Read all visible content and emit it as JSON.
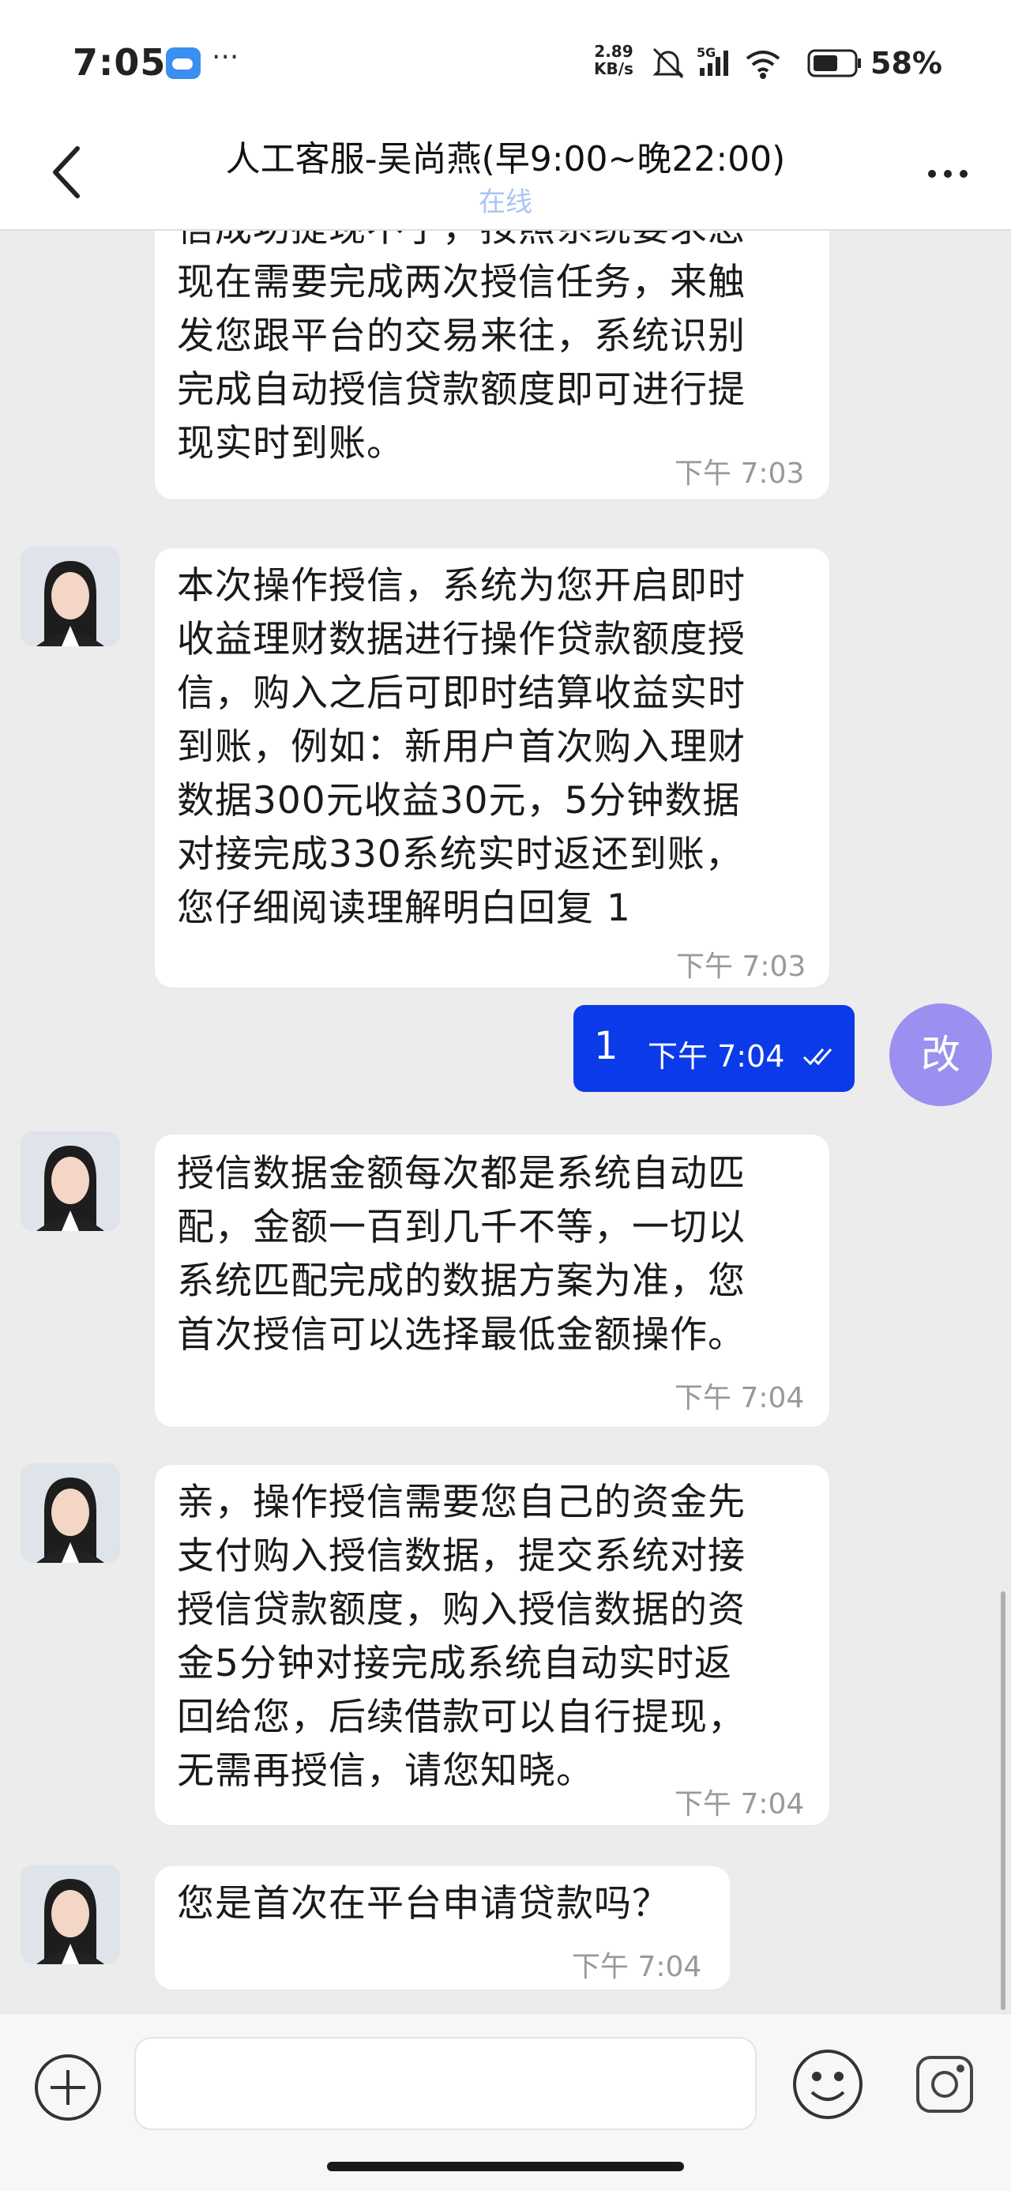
{
  "status_bar": {
    "time": "7:05",
    "more": "···",
    "speed_value": "2.89",
    "speed_unit": "KB/s",
    "network": "5G",
    "battery": "58%"
  },
  "header": {
    "title": "人工客服-吴尚燕(早9:00~晚22:00)",
    "status": "在线"
  },
  "messages": [
    {
      "lines": [
        "信成功提现不了，按照系统要求您",
        "现在需要完成两次授信任务，来触",
        "发您跟平台的交易来往，系统识别",
        "完成自动授信贷款额度即可进行提",
        "现实时到账。"
      ],
      "time": "下午  7:03"
    },
    {
      "lines": [
        "本次操作授信，系统为您开启即时",
        "收益理财数据进行操作贷款额度授",
        "信，购入之后可即时结算收益实时",
        "到账，例如：新用户首次购入理财",
        "数据300元收益30元，5分钟数据",
        "对接完成330系统实时返还到账，",
        "您仔细阅读理解明白回复 1"
      ],
      "time": "下午  7:03"
    },
    {
      "text": "1",
      "time": "下午  7:04",
      "avatar_text": "改"
    },
    {
      "lines": [
        "授信数据金额每次都是系统自动匹",
        "配，金额一百到几千不等，一切以",
        "系统匹配完成的数据方案为准，您",
        "首次授信可以选择最低金额操作。"
      ],
      "time": "下午  7:04"
    },
    {
      "lines": [
        "亲，操作授信需要您自己的资金先",
        "支付购入授信数据，提交系统对接",
        "授信贷款额度，购入授信数据的资",
        "金5分钟对接完成系统自动实时返",
        "回给您，后续借款可以自行提现，",
        "无需再授信，请您知晓。"
      ],
      "time": "下午  7:04"
    },
    {
      "lines": [
        "您是首次在平台申请贷款吗？"
      ],
      "time": "下午  7:04"
    }
  ],
  "input": {
    "value": "",
    "placeholder": ""
  },
  "icons": {
    "back": "chevron-left-icon",
    "more": "more-horizontal-icon",
    "add": "plus-circle-icon",
    "emoji": "smiley-icon",
    "camera": "camera-icon",
    "read_receipt": "double-check-icon"
  },
  "colors": {
    "outgoing_bubble": "#0b3be8",
    "self_avatar": "#9b8ff0",
    "online_status": "#a9c6f2",
    "chat_background": "#ececec"
  }
}
